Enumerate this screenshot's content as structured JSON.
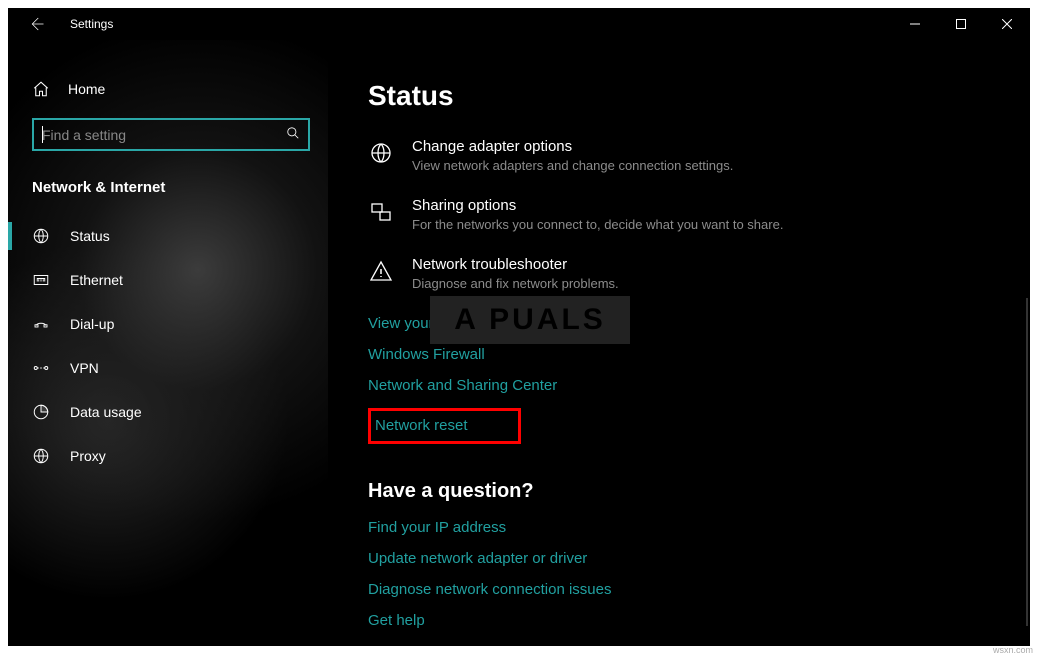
{
  "window": {
    "title": "Settings"
  },
  "sidebar": {
    "home": "Home",
    "search_placeholder": "Find a setting",
    "category": "Network & Internet",
    "items": [
      {
        "label": "Status",
        "icon": "globe",
        "selected": true
      },
      {
        "label": "Ethernet",
        "icon": "ethernet",
        "selected": false
      },
      {
        "label": "Dial-up",
        "icon": "dialup",
        "selected": false
      },
      {
        "label": "VPN",
        "icon": "vpn",
        "selected": false
      },
      {
        "label": "Data usage",
        "icon": "data",
        "selected": false
      },
      {
        "label": "Proxy",
        "icon": "globe",
        "selected": false
      }
    ]
  },
  "content": {
    "title": "Status",
    "options": [
      {
        "title": "Change adapter options",
        "desc": "View network adapters and change connection settings."
      },
      {
        "title": "Sharing options",
        "desc": "For the networks you connect to, decide what you want to share."
      },
      {
        "title": "Network troubleshooter",
        "desc": "Diagnose and fix network problems."
      }
    ],
    "links": [
      "View your network properties",
      "Windows Firewall",
      "Network and Sharing Center",
      "Network reset"
    ],
    "question_heading": "Have a question?",
    "help_links": [
      "Find your IP address",
      "Update network adapter or driver",
      "Diagnose network connection issues",
      "Get help"
    ]
  },
  "watermark": {
    "brand_text": "A  PUALS",
    "source": "wsxn.com"
  }
}
